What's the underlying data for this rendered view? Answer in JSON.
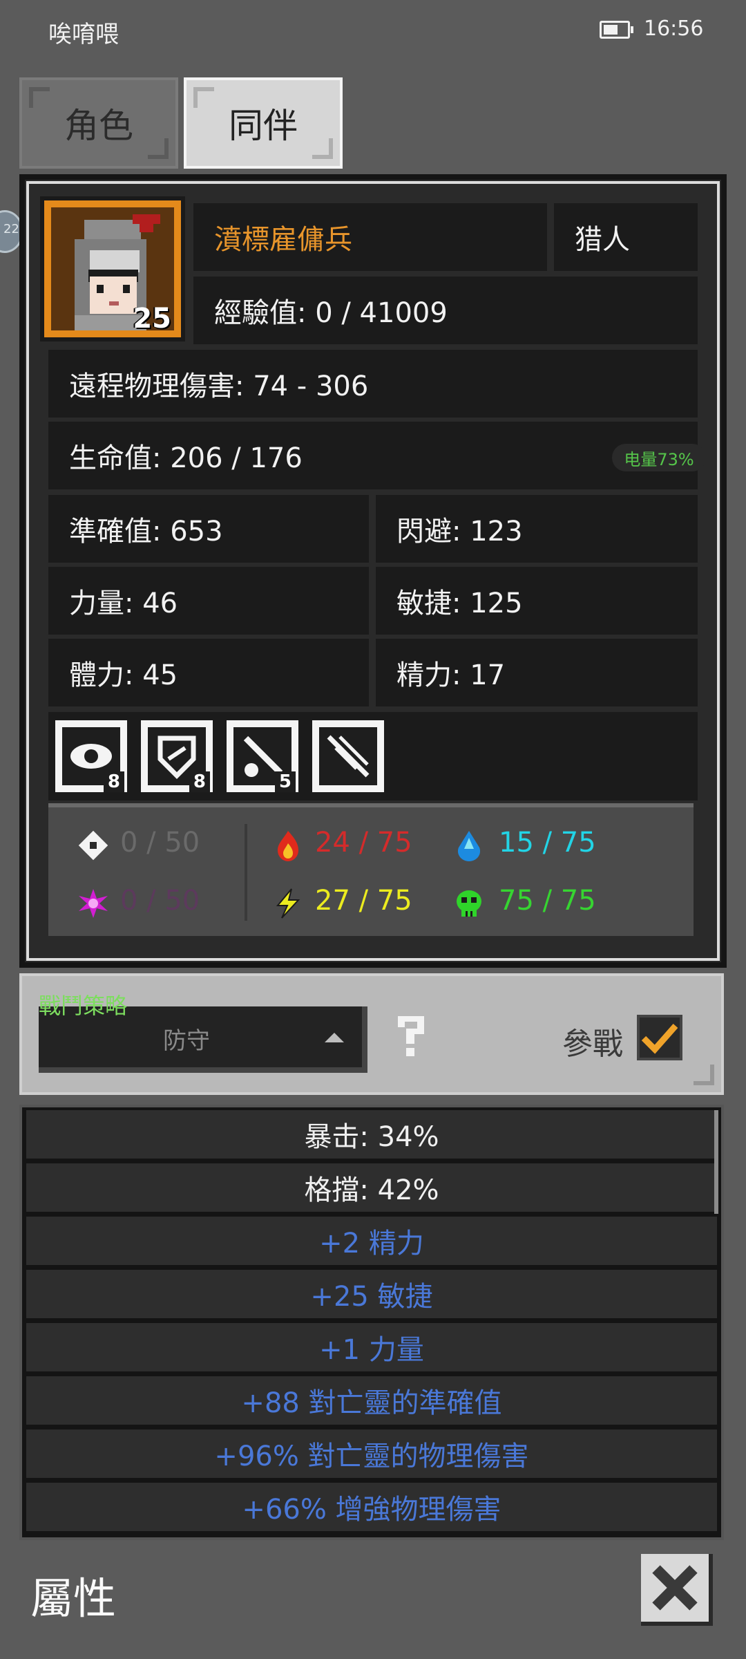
{
  "status_bar": {
    "title": "唉唷喂",
    "time": "16:56",
    "battery_icon": "battery-icon"
  },
  "tabs": [
    {
      "label": "角色",
      "selected": false
    },
    {
      "label": "同伴",
      "selected": true
    }
  ],
  "companion": {
    "name": "濆標雇傭兵",
    "class": "猎人",
    "level": "25",
    "experience": "經驗值: 0 / 41009",
    "ranged_damage": "遠程物理傷害: 74 - 306",
    "hp": "生命值: 206 / 176",
    "accuracy": "準確值: 653",
    "dodge": "閃避: 123",
    "strength": "力量: 46",
    "agility": "敏捷: 125",
    "stamina": "體力: 45",
    "spirit": "精力: 17"
  },
  "power_badge": "电量73%",
  "skills": [
    {
      "icon": "eye-skill-icon",
      "count": "8"
    },
    {
      "icon": "shield-skill-icon",
      "count": "8"
    },
    {
      "icon": "sword-skill-icon",
      "count": "5"
    },
    {
      "icon": "crossed-arrows-skill-icon",
      "count": ""
    }
  ],
  "resistances": {
    "physical": {
      "icon": "shuriken-icon",
      "value": "0 / 50",
      "color": "#6a6a6a"
    },
    "fire": {
      "icon": "fire-icon",
      "value": "24 / 75",
      "color": "#d42b2b"
    },
    "water": {
      "icon": "water-drop-icon",
      "value": "15 / 75",
      "color": "#22d4e6"
    },
    "arcane": {
      "icon": "magic-burst-icon",
      "value": "0 / 50",
      "color": "#5c3a5c"
    },
    "lightning": {
      "icon": "lightning-icon",
      "value": "27 / 75",
      "color": "#ecec1f"
    },
    "poison": {
      "icon": "skull-icon",
      "value": "75 / 75",
      "color": "#36d531"
    }
  },
  "strategy": {
    "label": "戰鬥策略",
    "value": "防守",
    "join_label": "參戰",
    "join_checked": true
  },
  "bonuses": [
    {
      "text": "暴击: 34%",
      "color": "#f0f0f0"
    },
    {
      "text": "格擋: 42%",
      "color": "#f0f0f0"
    },
    {
      "text": "+2 精力",
      "color": "#4a78d8"
    },
    {
      "text": "+25 敏捷",
      "color": "#4a78d8"
    },
    {
      "text": "+1 力量",
      "color": "#4a78d8"
    },
    {
      "text": "+88 對亡靈的準確值",
      "color": "#4a78d8"
    },
    {
      "text": "+96% 對亡靈的物理傷害",
      "color": "#4a78d8"
    },
    {
      "text": "+66% 增強物理傷害",
      "color": "#4a78d8"
    }
  ],
  "footer": {
    "title": "屬性",
    "close_icon": "close-icon"
  },
  "side_bubble_text": "22"
}
